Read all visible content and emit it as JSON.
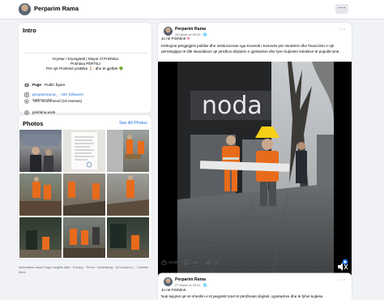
{
  "profile": {
    "name": "Perparim Rama"
  },
  "intro": {
    "title": "Intro",
    "bio": [
      "Kryetar i Kryeqytetit | Mayor of Prishtina",
      "Prishtina PËRTEJ",
      "Për një Prishtinë praktike 🚶, dhe të gjelbër 🌳."
    ],
    "category_label": "Page",
    "category_value": "Public figure",
    "instagram_handle": "perparimrama_",
    "instagram_followers": "19K followers",
    "instagram_sub": "Confirmed link",
    "website": "prishtina.work",
    "recommend": "78% recommend (18 reviews)"
  },
  "photos": {
    "title": "Photos",
    "see_all": "See All Photos"
  },
  "footer": "Information about Page Insights data · Privacy · Terms · Advertising · Ad choices ▷ · Cookies · More",
  "post1": {
    "author": "Perparim Rama",
    "date": "28 March at 09:20 · 🌐",
    "headline": "Jo në Prishtinë",
    "body": "Kërkojmë përgjegjësi politike dhe institucionale nga Kuvendi i Kosovës për miratimin dhe financimin e një përmbajtjeje të tillë skandaloze që përdhos dinjitetin e qytetarëve dhe fyen kujtesën kolektive të popullit tonë.",
    "storefront": "noda",
    "likes": "19.5K",
    "comments": "1.5K",
    "shares": "226"
  },
  "post2": {
    "author": "Perparim Rama",
    "date": "27 March at 20:41 · 🌐",
    "headline": "Jo në Prishtinë.",
    "body": "Nuk lejojmë që në sheshin e Kryeqytetit tonë të përdhoset dinjiteti i qytetarëve dhe të fyhet kujtesa"
  },
  "colors": {
    "accent": "#216fdb",
    "brand": "#1877f2",
    "page_bg": "#f0f2f5"
  },
  "icons": [
    "page-icon",
    "instagram-icon",
    "link-icon",
    "star-icon",
    "more-icon",
    "globe-icon",
    "mute-icon",
    "like-icon",
    "comment-icon",
    "share-icon"
  ]
}
